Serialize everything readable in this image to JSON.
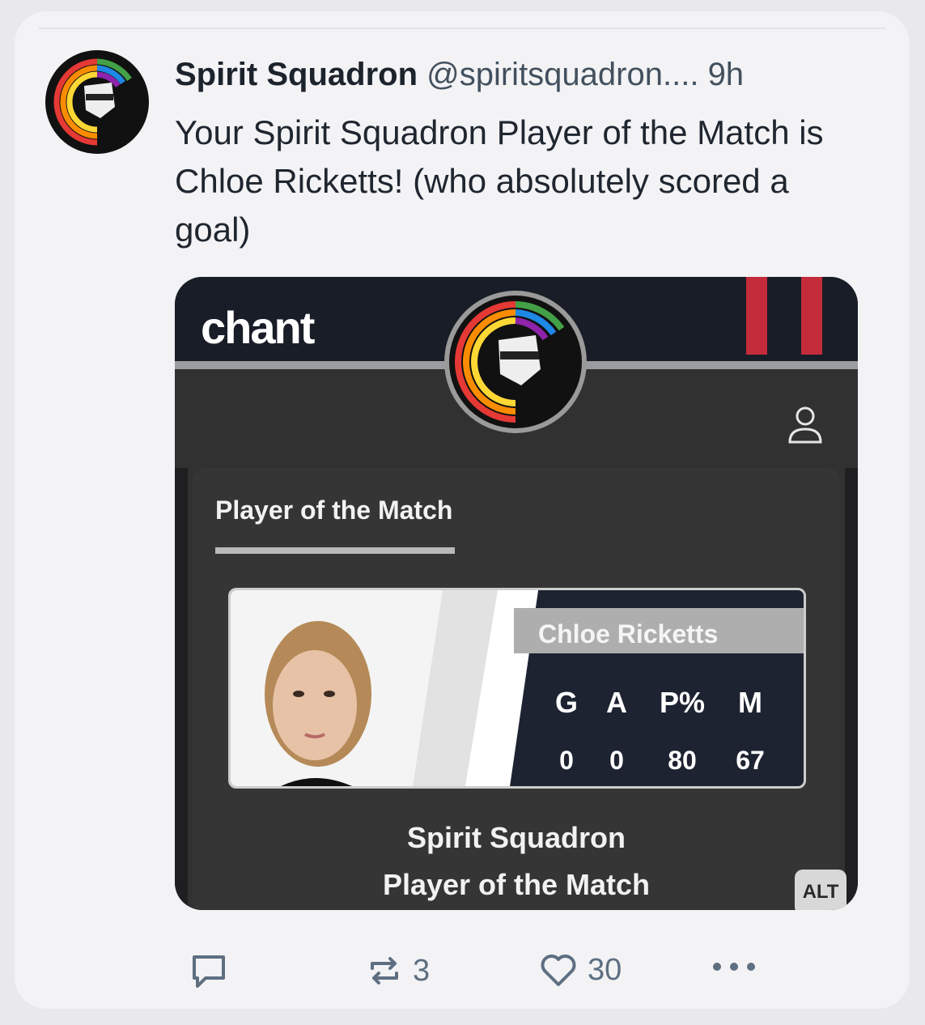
{
  "post": {
    "display_name": "Spirit Squadron",
    "handle": "@spiritsquadron....",
    "time": "9h",
    "text": "Your Spirit Squadron Player of the Match is Chloe Ricketts! (who absolutely scored a goal)",
    "avatar_icon": "spirit-squadron-logo-icon"
  },
  "embed": {
    "brand": "chant",
    "section_title": "Player of the Match",
    "player": {
      "name": "Chloe Ricketts",
      "stats_headers": [
        "G",
        "A",
        "P%",
        "M"
      ],
      "stats_values": [
        "0",
        "0",
        "80",
        "67"
      ]
    },
    "caption_line1": "Spirit Squadron",
    "caption_line2": "Player of the Match",
    "alt_label": "ALT",
    "colors": {
      "header": "#181d27",
      "stripes": "#c42b3b",
      "panel": "#353535"
    }
  },
  "actions": {
    "reply_icon": "reply-icon",
    "repost_icon": "repost-icon",
    "repost_count": "3",
    "like_icon": "heart-icon",
    "like_count": "30",
    "more_icon": "more-icon"
  }
}
